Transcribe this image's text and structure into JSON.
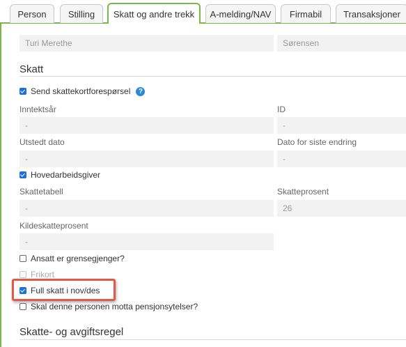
{
  "tabs": [
    {
      "label": "Person"
    },
    {
      "label": "Stilling"
    },
    {
      "label": "Skatt og andre trekk",
      "active": true
    },
    {
      "label": "A-melding/NAV"
    },
    {
      "label": "Firmabil"
    },
    {
      "label": "Transaksjoner"
    }
  ],
  "person": {
    "first_name": "Turi Merethe",
    "last_name": "Sørensen"
  },
  "skatt": {
    "title": "Skatt",
    "send_request_label": "Send skattekortforespørsel",
    "send_request_checked": true,
    "help_glyph": "?",
    "inntektsar_label": "Inntektsår",
    "inntektsar_value": "-",
    "id_label": "ID",
    "id_value": "-",
    "utstedt_label": "Utstedt dato",
    "utstedt_value": "-",
    "endring_label": "Dato for siste endring",
    "endring_value": "-",
    "hovedarbeidsgiver_label": "Hovedarbeidsgiver",
    "hovedarbeidsgiver_checked": true,
    "skattetabell_label": "Skattetabell",
    "skattetabell_value": "-",
    "skatteprosent_label": "Skatteprosent",
    "skatteprosent_value": "26",
    "kildeskatt_label": "Kildeskatteprosent",
    "kildeskatt_value": "-",
    "grensegjenger_label": "Ansatt er grensegjenger?",
    "grensegjenger_checked": false,
    "frikort_label": "Frikort",
    "frikort_checked": false,
    "fullskatt_label": "Full skatt i nov/des",
    "fullskatt_checked": true,
    "pensjon_label": "Skal denne personen motta pensjonsytelser?",
    "pensjon_checked": false
  },
  "regel": {
    "title": "Skatte- og avgiftsregel"
  },
  "colors": {
    "accent_green": "#7ab648",
    "checkbox_blue": "#1e6fd9",
    "highlight_red": "#e05a45",
    "help_blue": "#2a8ad4"
  }
}
